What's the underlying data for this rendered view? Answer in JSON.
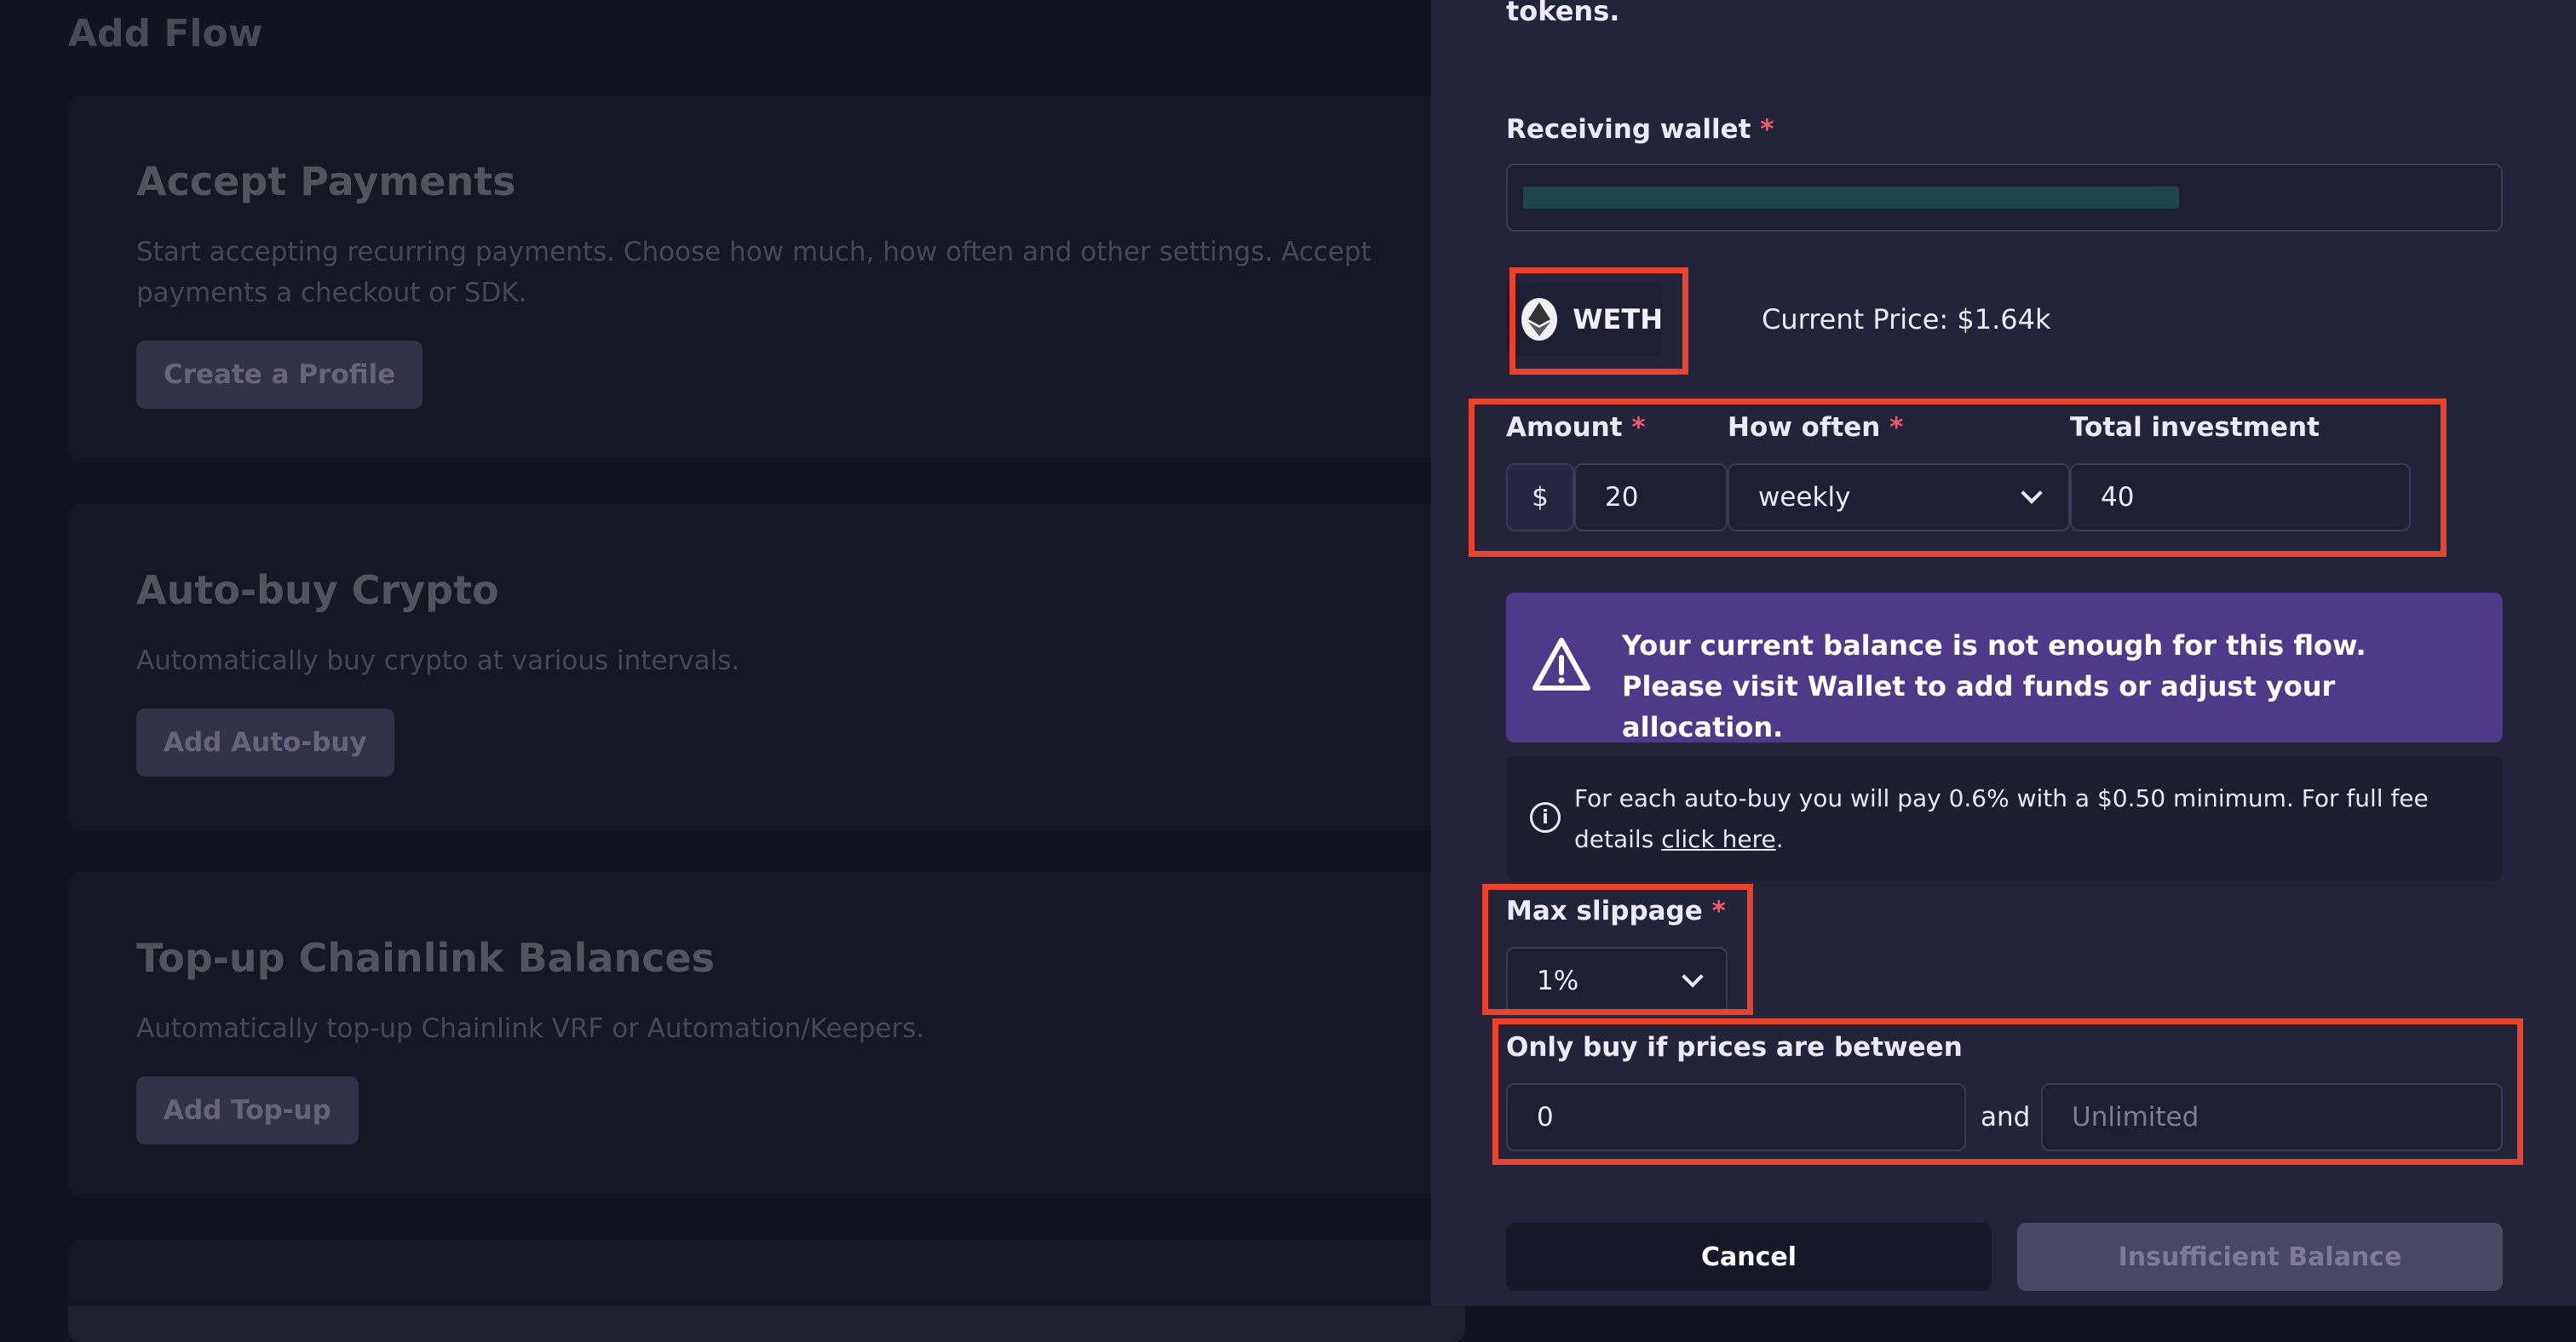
{
  "background": {
    "page_title": "Add Flow",
    "cards": [
      {
        "title": "Accept Payments",
        "description": "Start accepting recurring payments. Choose how much, how often and other settings. Accept payments a checkout or SDK.",
        "button": "Create a Profile"
      },
      {
        "title": "Auto-buy Crypto",
        "description": "Automatically buy crypto at various intervals.",
        "button": "Add Auto-buy"
      },
      {
        "title": "Top-up Chainlink Balances",
        "description": "Automatically top-up Chainlink VRF or Automation/Keepers.",
        "button": "Add Top-up"
      }
    ]
  },
  "drawer": {
    "top_text": "tokens.",
    "receiving_wallet": {
      "label": "Receiving wallet",
      "required_mark": "*"
    },
    "token": {
      "symbol": "WETH",
      "icon": "ethereum-icon",
      "current_price": "Current Price: $1.64k"
    },
    "amount": {
      "label": "Amount",
      "required_mark": "*",
      "currency": "$",
      "value": "20"
    },
    "how_often": {
      "label": "How often",
      "required_mark": "*",
      "selected": "weekly"
    },
    "total_investment": {
      "label": "Total investment",
      "value": "40"
    },
    "warning": {
      "icon": "warning-triangle-icon",
      "text": "Your current balance is not enough for this flow. Please visit Wallet to add funds or adjust your allocation."
    },
    "fee_info": {
      "icon": "info-circle-icon",
      "text": "For each auto-buy you will pay 0.6% with a $0.50 minimum. For full fee details",
      "link": "click here",
      "suffix": "."
    },
    "max_slippage": {
      "label": "Max slippage",
      "required_mark": "*",
      "selected": "1%"
    },
    "price_range": {
      "label": "Only buy if prices are between",
      "min_value": "0",
      "connector": "and",
      "max_placeholder": "Unlimited"
    },
    "buttons": {
      "cancel": "Cancel",
      "submit": "Insufficient Balance"
    }
  },
  "colors": {
    "drawer_bg": "#232439",
    "warning_bg": "#4f3a8a",
    "highlight": "#e8432d",
    "required": "#ee5a68"
  }
}
